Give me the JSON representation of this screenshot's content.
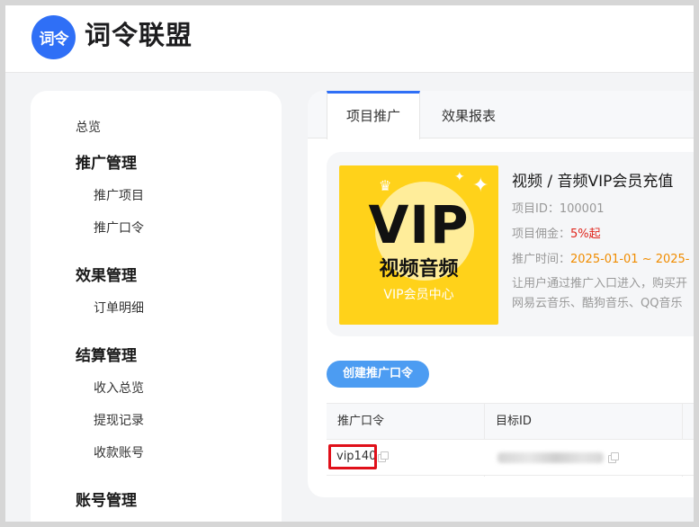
{
  "header": {
    "logo_text": "词令",
    "brand_name": "词令联盟",
    "brand_color": "#2f6ff6"
  },
  "sidebar": {
    "overview": "总览",
    "groups": [
      {
        "title": "推广管理",
        "items": [
          "推广项目",
          "推广口令"
        ]
      },
      {
        "title": "效果管理",
        "items": [
          "订单明细"
        ]
      },
      {
        "title": "结算管理",
        "items": [
          "收入总览",
          "提现记录",
          "收款账号"
        ]
      },
      {
        "title": "账号管理",
        "items": []
      }
    ]
  },
  "tabs": [
    {
      "label": "项目推广",
      "active": true
    },
    {
      "label": "效果报表",
      "active": false
    }
  ],
  "project": {
    "thumbnail": {
      "big_text": "VIP",
      "sub_text": "视频音频",
      "center_text": "VIP会员中心"
    },
    "title": "视频 / 音频VIP会员充值",
    "id_label": "项目ID：",
    "id_value": "100001",
    "commission_label": "项目佣金：",
    "commission_value": "5%起",
    "time_label": "推广时间：",
    "time_value": "2025-01-01 ~ 2025-",
    "desc_line1": "让用户通过推广入口进入，购买开",
    "desc_line2": "网易云音乐、酷狗音乐、QQ音乐"
  },
  "create_button_label": "创建推广口令",
  "table": {
    "headers": [
      "推广口令",
      "目标ID"
    ],
    "rows": [
      {
        "code": "vip140",
        "target_id": ""
      }
    ]
  },
  "colors": {
    "accent_blue": "#2f6ff6",
    "button_blue": "#4c9cf2",
    "highlight_red": "#e0101a",
    "commission_red": "#e0271e",
    "time_orange": "#f08c00"
  }
}
